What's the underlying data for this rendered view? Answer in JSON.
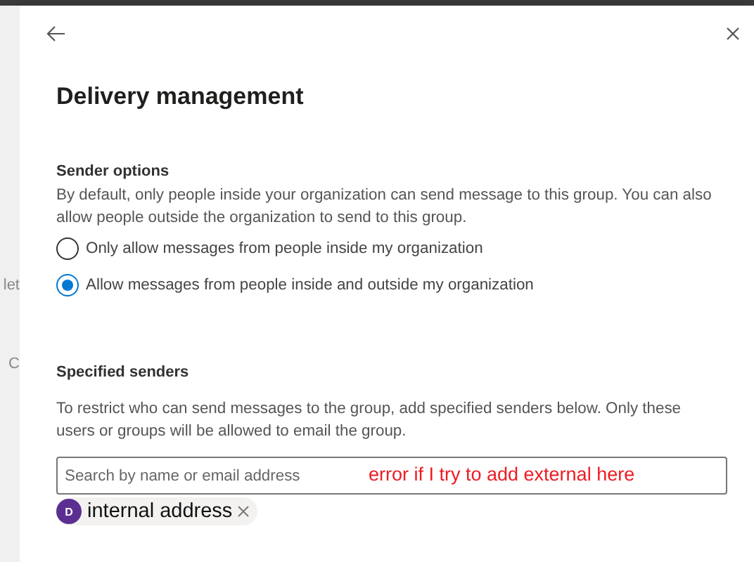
{
  "background": {
    "fragments": [
      "let",
      "C"
    ]
  },
  "panel": {
    "title": "Delivery management"
  },
  "sender_options": {
    "heading": "Sender options",
    "description": "By default, only people inside your organization can send message to this group. You can also allow people outside the organization to send to this group.",
    "options": [
      {
        "label": "Only allow messages from people inside my organization",
        "selected": false
      },
      {
        "label": "Allow messages from people inside and outside my organization",
        "selected": true
      }
    ]
  },
  "specified_senders": {
    "heading": "Specified senders",
    "description": "To restrict who can send messages to the group, add specified senders below. Only these users or groups will be allowed to email the group.",
    "search": {
      "placeholder": "Search by name or email address"
    },
    "annotation": "error if I try to add external here",
    "chips": [
      {
        "initial": "D",
        "label": "internal address",
        "color": "#5c2e91"
      }
    ]
  }
}
